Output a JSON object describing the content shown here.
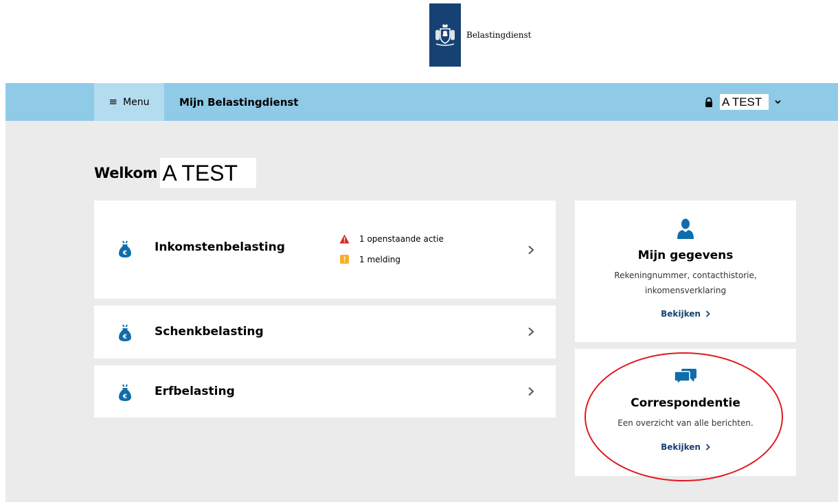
{
  "header": {
    "brand": "Belastingdienst"
  },
  "nav": {
    "menu_label": "Menu",
    "app_title": "Mijn Belastingdienst",
    "user_name": "A TEST"
  },
  "welcome": {
    "label": "Welkom",
    "name": "A TEST"
  },
  "taxes": [
    {
      "title": "Inkomstenbelasting",
      "notices": [
        {
          "icon": "warning-triangle-icon",
          "text": "1 openstaande actie",
          "color": "#d52b1e"
        },
        {
          "icon": "exclamation-square-icon",
          "text": "1 melding",
          "color": "#f6b12b"
        }
      ]
    },
    {
      "title": "Schenkbelasting"
    },
    {
      "title": "Erfbelasting"
    }
  ],
  "side": [
    {
      "icon": "person-icon",
      "title": "Mijn gegevens",
      "desc_line1": "Rekeningnummer, contacthistorie,",
      "desc_line2": "inkomensverklaring",
      "link": "Bekijken"
    },
    {
      "icon": "chat-bubbles-icon",
      "title": "Correspondentie",
      "desc": "Een overzicht van alle berichten.",
      "link": "Bekijken"
    }
  ],
  "colors": {
    "nav_bg": "#8fcae7",
    "brand_blue": "#154273",
    "icon_blue": "#0f6dab",
    "highlight": "#e0181f"
  }
}
